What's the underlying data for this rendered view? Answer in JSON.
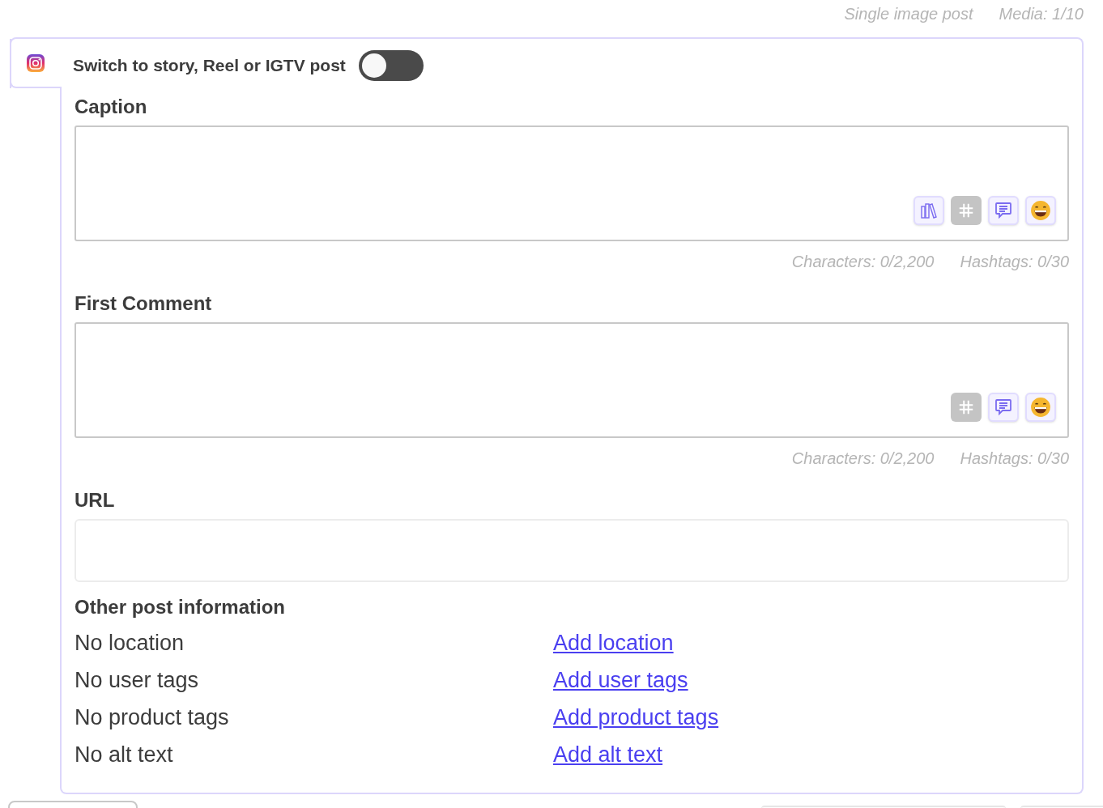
{
  "header": {
    "post_type": "Single image post",
    "media": "Media: 1/10"
  },
  "story_switch": {
    "label": "Switch to story, Reel or IGTV post",
    "on": false
  },
  "caption": {
    "label": "Caption",
    "tools": [
      {
        "kind": "library",
        "disabled": false
      },
      {
        "kind": "hashtag",
        "disabled": true
      },
      {
        "kind": "comment",
        "disabled": false
      },
      {
        "kind": "emoji",
        "disabled": false
      }
    ],
    "characters": "Characters: 0/2,200",
    "hashtags": "Hashtags: 0/30"
  },
  "first_comment": {
    "label": "First Comment",
    "tools": [
      {
        "kind": "hashtag",
        "disabled": true
      },
      {
        "kind": "comment",
        "disabled": false
      },
      {
        "kind": "emoji",
        "disabled": false
      }
    ],
    "characters": "Characters: 0/2,200",
    "hashtags": "Hashtags: 0/30"
  },
  "url": {
    "label": "URL"
  },
  "other_info": {
    "title": "Other post information",
    "rows": [
      {
        "status": "No location",
        "link": "Add location"
      },
      {
        "status": "No user tags",
        "link": "Add user tags"
      },
      {
        "status": "No product tags",
        "link": "Add product tags"
      },
      {
        "status": "No alt text",
        "link": "Add alt text"
      }
    ]
  }
}
